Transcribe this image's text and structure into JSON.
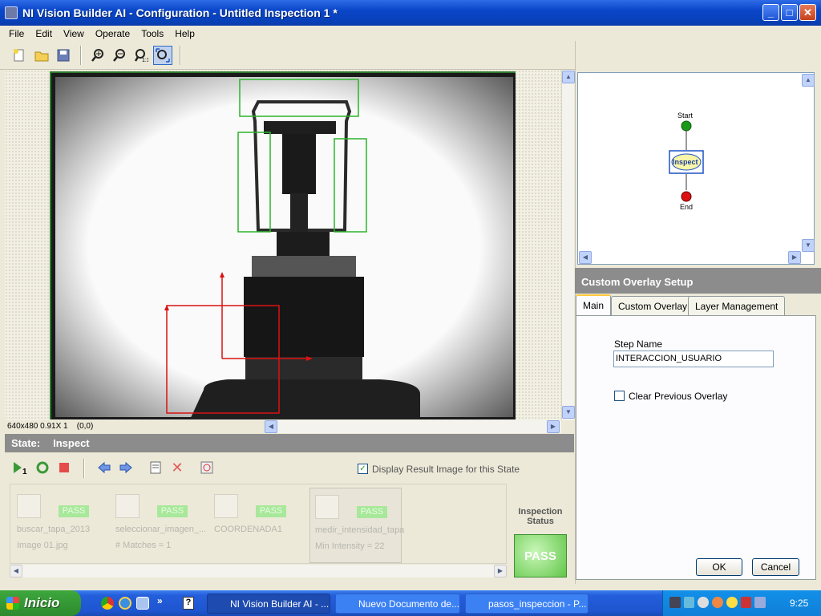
{
  "window": {
    "title": "NI Vision Builder AI - Configuration - Untitled Inspection 1 *"
  },
  "menu": [
    "File",
    "Edit",
    "View",
    "Operate",
    "Tools",
    "Help"
  ],
  "toolbar": {
    "icons": [
      "new-file-icon",
      "open-folder-icon",
      "save-icon",
      "zoom-in-icon",
      "zoom-out-icon",
      "zoom-1to1-icon",
      "zoom-fit-icon"
    ]
  },
  "image_status": {
    "info": "640x480 0.91X 1",
    "coords": "(0,0)"
  },
  "state": {
    "label": "State:",
    "value": "Inspect"
  },
  "display_result": {
    "label": "Display Result Image for this State",
    "checked": true
  },
  "steps": [
    {
      "name": "buscar_tapa_2013",
      "result": "Image 01.jpg",
      "status": "PASS"
    },
    {
      "name": "seleccionar_imagen_...",
      "result": "# Matches = 1",
      "status": "PASS"
    },
    {
      "name": "COORDENADA1",
      "result": "",
      "status": "PASS"
    },
    {
      "name": "medir_intensidad_tapa",
      "result": "Min Intensity = 22",
      "status": "PASS"
    }
  ],
  "inspection": {
    "label": "Inspection Status",
    "status": "PASS"
  },
  "flow": {
    "start": "Start",
    "inspect": "Inspect",
    "end": "End"
  },
  "overlay_setup": {
    "title": "Custom Overlay Setup",
    "tabs": [
      "Main",
      "Custom Overlay",
      "Layer Management"
    ],
    "step_name_label": "Step Name",
    "step_name_value": "INTERACCION_USUARIO",
    "clear_label": "Clear Previous Overlay",
    "ok": "OK",
    "cancel": "Cancel"
  },
  "taskbar": {
    "start": "Inicio",
    "tasks": [
      "NI Vision Builder AI - ...",
      "Nuevo Documento de...",
      "pasos_inspeccion - P..."
    ],
    "clock": "9:25"
  }
}
